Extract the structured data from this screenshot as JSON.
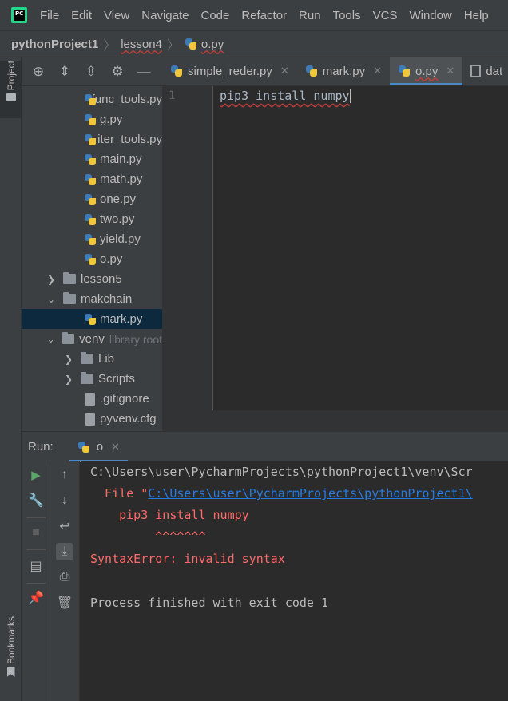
{
  "menu": {
    "items": [
      {
        "label": "File"
      },
      {
        "label": "Edit"
      },
      {
        "label": "View"
      },
      {
        "label": "Navigate"
      },
      {
        "label": "Code"
      },
      {
        "label": "Refactor"
      },
      {
        "label": "Run"
      },
      {
        "label": "Tools"
      },
      {
        "label": "VCS"
      },
      {
        "label": "Window"
      },
      {
        "label": "Help"
      }
    ],
    "logo_text": "PC"
  },
  "breadcrumb": {
    "project": "pythonProject1",
    "folder": "lesson4",
    "file": "o.py"
  },
  "left_strip": {
    "project_tab": "Project",
    "bookmarks_tab": "Bookmarks"
  },
  "project_tree": {
    "items": [
      {
        "label": "func_tools.py"
      },
      {
        "label": "g.py"
      },
      {
        "label": "iter_tools.py"
      },
      {
        "label": "main.py"
      },
      {
        "label": "math.py"
      },
      {
        "label": "one.py"
      },
      {
        "label": "two.py"
      },
      {
        "label": "yield.py"
      },
      {
        "label": "o.py"
      },
      {
        "label": "lesson5"
      },
      {
        "label": "makchain"
      },
      {
        "label": "mark.py"
      },
      {
        "label": "venv",
        "hint": "library root"
      },
      {
        "label": "Lib"
      },
      {
        "label": "Scripts"
      },
      {
        "label": ".gitignore"
      },
      {
        "label": "pyvenv.cfg"
      }
    ]
  },
  "editor": {
    "tabs": [
      {
        "label": "simple_reder.py"
      },
      {
        "label": "mark.py"
      },
      {
        "label": "o.py"
      },
      {
        "label": "dat"
      }
    ],
    "line_number": "1",
    "code": "pip3 install numpy"
  },
  "run": {
    "label": "Run:",
    "tab": "o",
    "console": {
      "line1": "C:\\Users\\user\\PycharmProjects\\pythonProject1\\venv\\Scr",
      "line2_prefix": "  File \"",
      "line2_link": "C:\\Users\\user\\PycharmProjects\\pythonProject1\\",
      "line3": "    pip3 install numpy",
      "line4": "         ^^^^^^^",
      "line5": "SyntaxError: invalid syntax",
      "line6": "Process finished with exit code 1"
    }
  }
}
